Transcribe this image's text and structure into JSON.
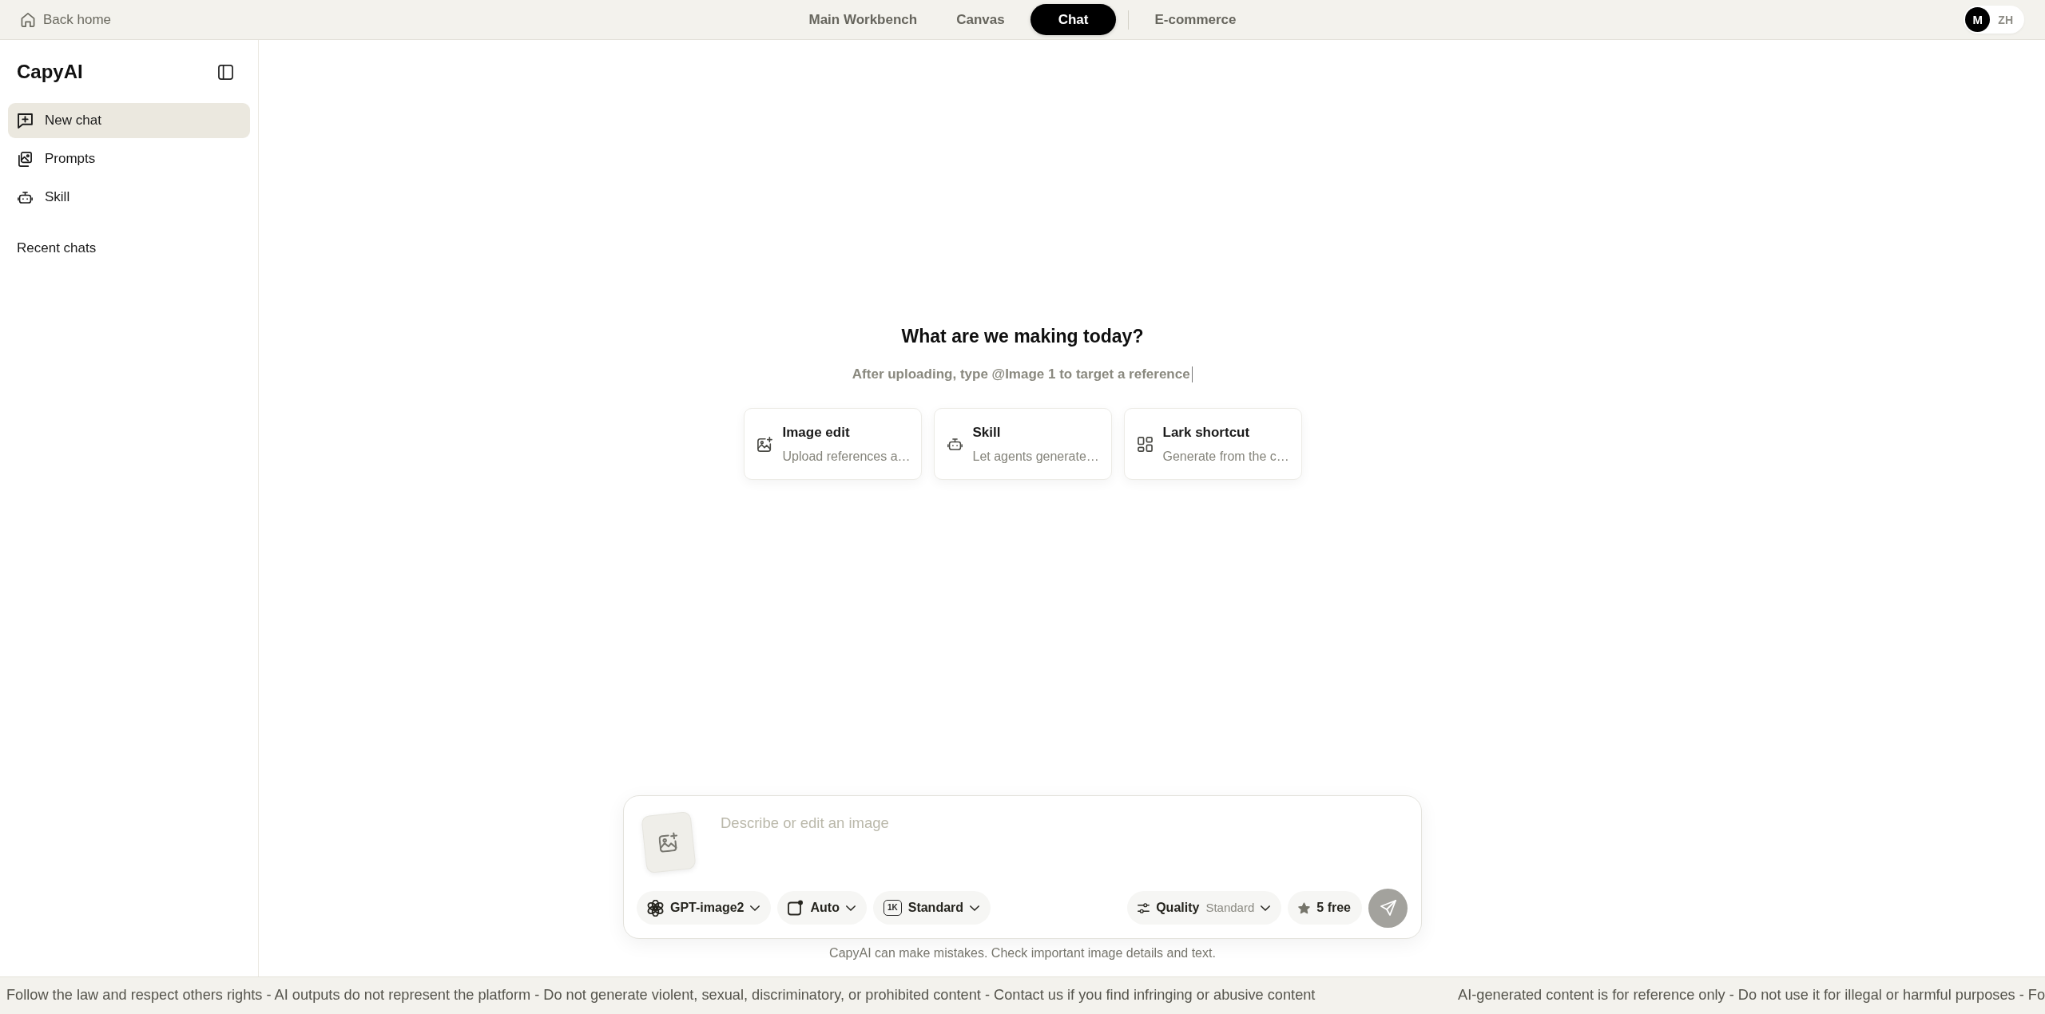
{
  "top_bar": {
    "back_link": "Back home",
    "nav_tabs": [
      {
        "label": "Main Workbench",
        "selected": false,
        "divider_before": false
      },
      {
        "label": "Canvas",
        "selected": false,
        "divider_before": false
      },
      {
        "label": "Chat",
        "selected": true,
        "divider_before": false
      },
      {
        "label": "E-commerce",
        "selected": false,
        "divider_before": true
      }
    ],
    "mode_switch": [
      {
        "label": "M",
        "selected": true
      },
      {
        "label": "ZH",
        "selected": false
      }
    ]
  },
  "sidebar": {
    "title": "CapyAI",
    "items": [
      {
        "label": "New chat",
        "selected": true
      },
      {
        "label": "Prompts",
        "selected": false
      },
      {
        "label": "Skill",
        "selected": false
      }
    ],
    "section_title": "Recent chats"
  },
  "main": {
    "heading": "What are we making today?",
    "subtitle": "After uploading, type @Image 1 to target a reference",
    "subtitle_cursor": true,
    "shortcut_cards": [
      {
        "title": "Image edit",
        "description": "Upload references a…"
      },
      {
        "title": "Skill",
        "description": "Let agents generate…"
      },
      {
        "title": "Lark shortcut",
        "description": "Generate from the c…"
      }
    ]
  },
  "composer": {
    "placeholder": "Describe or edit an image",
    "model": "GPT-image2",
    "aspect": "Auto",
    "size_tag": "1K",
    "resolution": "Standard",
    "quality_label": "Quality",
    "quality_value": "Standard",
    "credits": "5 free",
    "send_disabled": true,
    "disclaimer": "CapyAI can make mistakes. Check important image details and text."
  },
  "ticker": [
    "Follow the law and respect others rights - AI outputs do not represent the platform - Do not generate violent, sexual, discriminatory, or prohibited content - Contact us if you find infringing or abusive content",
    "AI-generated content is for reference only - Do not use it for illegal or harmful purposes - Fo"
  ]
}
